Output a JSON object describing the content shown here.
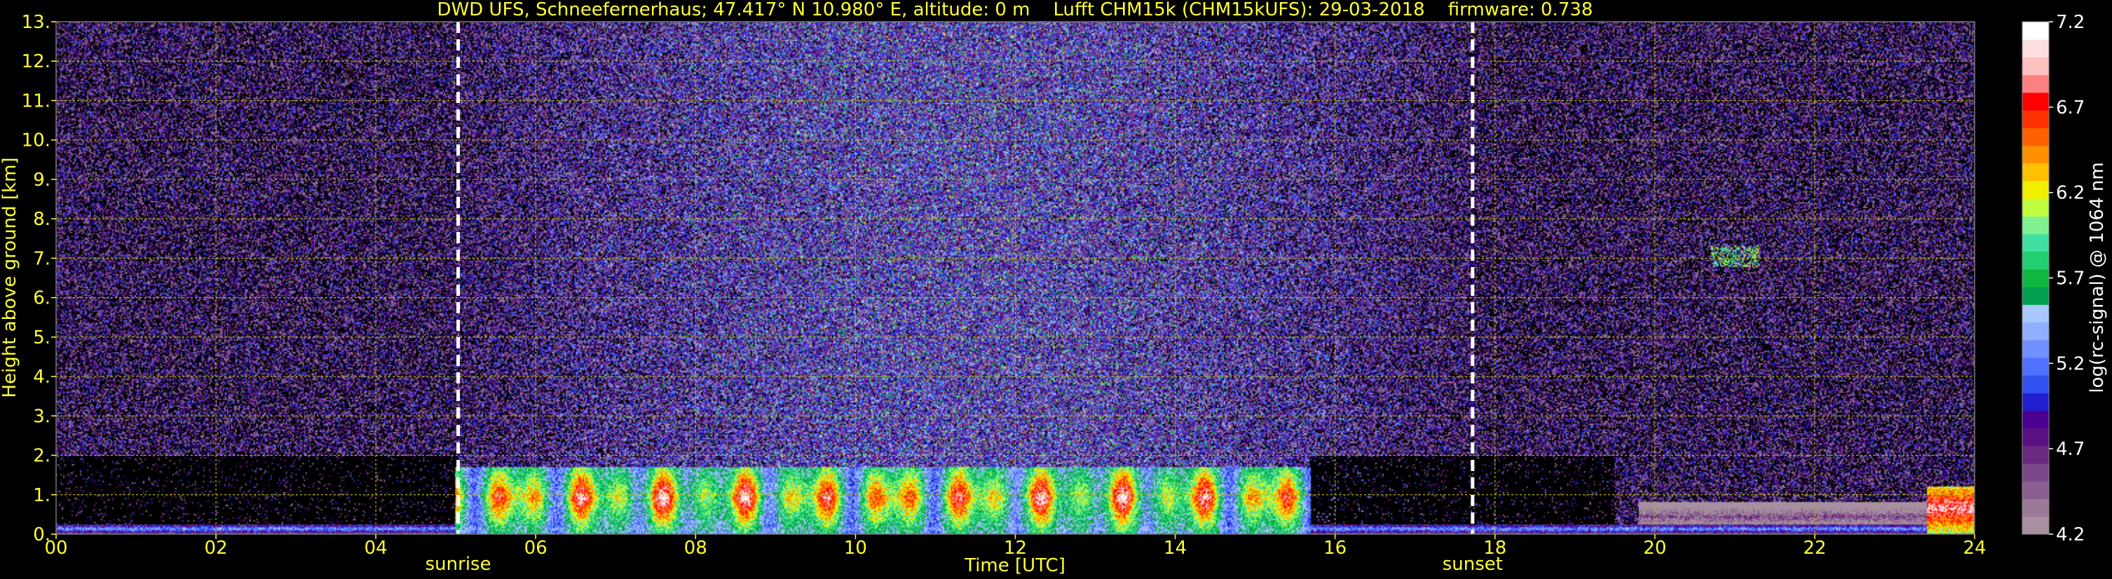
{
  "chart_data": {
    "type": "heatmap",
    "title": "DWD UFS, Schneefernerhaus; 47.417° N 10.980° E, altitude: 0 m    Lufft CHM15k (CHM15kUFS): 29-03-2018    firmware: 0.738",
    "xlabel": "Time [UTC]",
    "ylabel": "Height above ground [km]",
    "xlim": [
      0,
      24
    ],
    "ylim": [
      0,
      13
    ],
    "x_ticks": [
      "00",
      "02",
      "04",
      "06",
      "08",
      "10",
      "12",
      "14",
      "16",
      "18",
      "20",
      "22",
      "24"
    ],
    "y_ticks": [
      "0.",
      "1.",
      "2.",
      "3.",
      "4.",
      "5.",
      "6.",
      "7.",
      "8.",
      "9.",
      "10.",
      "11.",
      "12.",
      "13."
    ],
    "grid": true,
    "markers": [
      {
        "label": "sunrise",
        "time": 5.03
      },
      {
        "label": "sunset",
        "time": 17.72
      }
    ],
    "colorbar": {
      "label": "log(rc-signal) @ 1064 nm",
      "range": [
        4.2,
        7.2
      ],
      "tick_labels": [
        "4.2",
        "4.7",
        "5.2",
        "5.7",
        "6.2",
        "6.7",
        "7.2"
      ],
      "colors": [
        "#a890a0",
        "#9a7a98",
        "#8a6090",
        "#7a4888",
        "#6a2a80",
        "#5a1080",
        "#4a0090",
        "#2020d0",
        "#3050f0",
        "#5070ff",
        "#7090ff",
        "#90b0ff",
        "#a8c8ff",
        "#00a050",
        "#10b840",
        "#20d070",
        "#40e0a0",
        "#80f090",
        "#c0ff40",
        "#f0f000",
        "#ffc000",
        "#ff9000",
        "#ff6000",
        "#ff3000",
        "#ff0000",
        "#ff8080",
        "#ffc0c0",
        "#ffe0e0",
        "#ffffff"
      ]
    },
    "features": [
      {
        "name": "boundary layer",
        "start": 5.0,
        "end": 15.7,
        "top_km": 1.7,
        "peak": 6.9
      },
      {
        "name": "surface layer",
        "start": 0.0,
        "end": 24.0,
        "top_km": 0.25,
        "peak": 5.6
      },
      {
        "name": "evening residual layer",
        "start": 19.8,
        "end": 24.0,
        "top_km": 0.8,
        "peak": 4.8
      },
      {
        "name": "cloud",
        "start": 23.4,
        "end": 24.0,
        "top_km": 1.2,
        "peak": 7.2
      },
      {
        "name": "upper cloud",
        "start": 20.7,
        "end": 21.3,
        "top_km": 7.3,
        "peak": 6.3
      }
    ]
  }
}
